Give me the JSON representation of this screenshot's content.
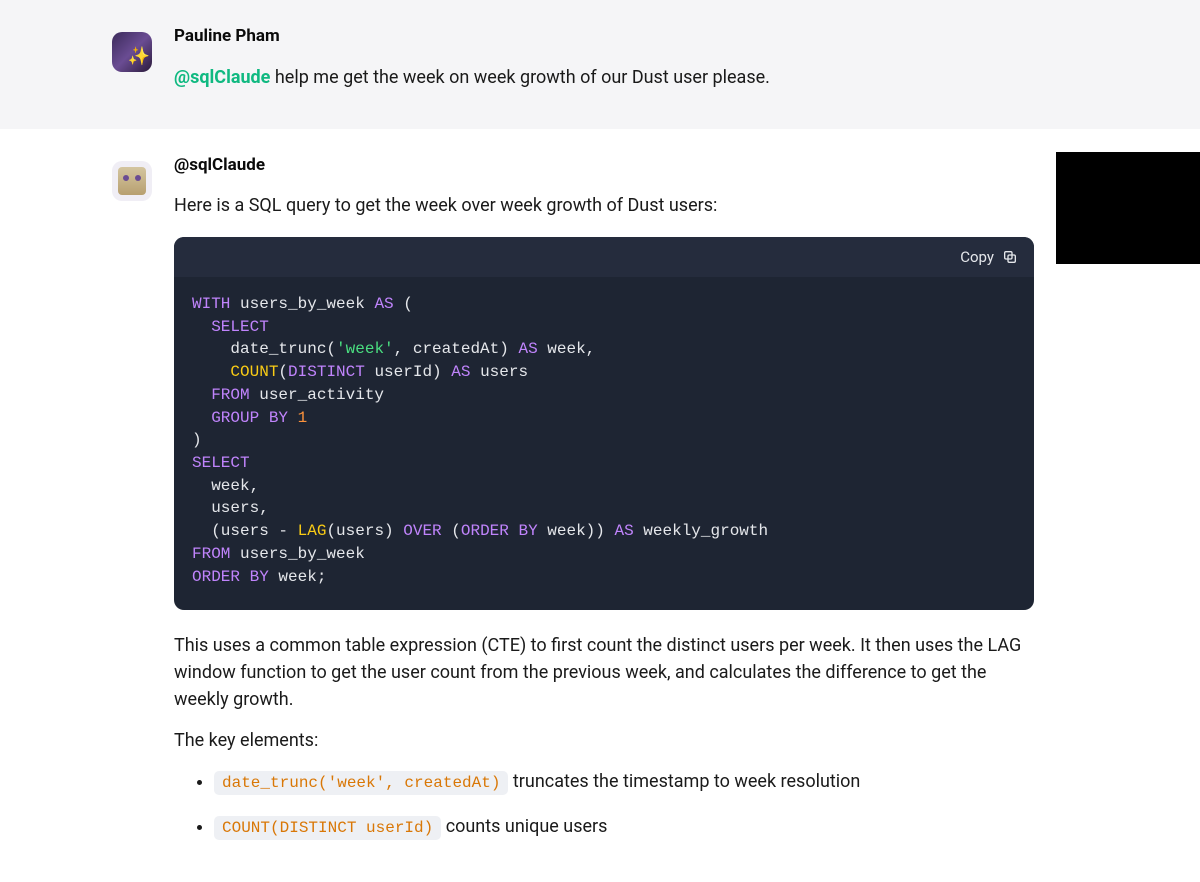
{
  "user_message": {
    "author": "Pauline Pham",
    "mention": "@sqlClaude",
    "text": " help me get the week on week growth of our Dust user please."
  },
  "assistant_message": {
    "author": "@sqlClaude",
    "intro": "Here is a SQL query to get the week over week growth of Dust users:",
    "copy_label": "Copy",
    "code": {
      "l1_kw1": "WITH",
      "l1_id": " users_by_week ",
      "l1_kw2": "AS",
      "l1_op": " (",
      "l2_kw": "SELECT",
      "l3_pre": "    date_trunc(",
      "l3_str": "'week'",
      "l3_mid": ", createdAt) ",
      "l3_kw": "AS",
      "l3_post": " week,",
      "l4_pre": "    ",
      "l4_fn": "COUNT",
      "l4_op1": "(",
      "l4_kw1": "DISTINCT",
      "l4_mid": " userId) ",
      "l4_kw2": "AS",
      "l4_post": " users",
      "l5_kw": "FROM",
      "l5_id": " user_activity",
      "l6_kw": "GROUP BY",
      "l6_sp": " ",
      "l6_num": "1",
      "l7": ")",
      "l8_kw": "SELECT",
      "l9": "  week,",
      "l10": "  users,",
      "l11_pre": "  (users - ",
      "l11_fn": "LAG",
      "l11_mid1": "(users) ",
      "l11_kw1": "OVER",
      "l11_mid2": " (",
      "l11_kw2": "ORDER BY",
      "l11_mid3": " week)) ",
      "l11_kw3": "AS",
      "l11_post": " weekly_growth",
      "l12_kw": "FROM",
      "l12_id": " users_by_week",
      "l13_kw": "ORDER BY",
      "l13_id": " week;"
    },
    "explanation": "This uses a common table expression (CTE) to first count the distinct users per week. It then uses the LAG window function to get the user count from the previous week, and calculates the difference to get the weekly growth.",
    "key_elements_label": "The key elements:",
    "bullets": [
      {
        "code": "date_trunc('week', createdAt)",
        "text": " truncates the timestamp to week resolution"
      },
      {
        "code": "COUNT(DISTINCT userId)",
        "text": " counts unique users"
      }
    ]
  }
}
